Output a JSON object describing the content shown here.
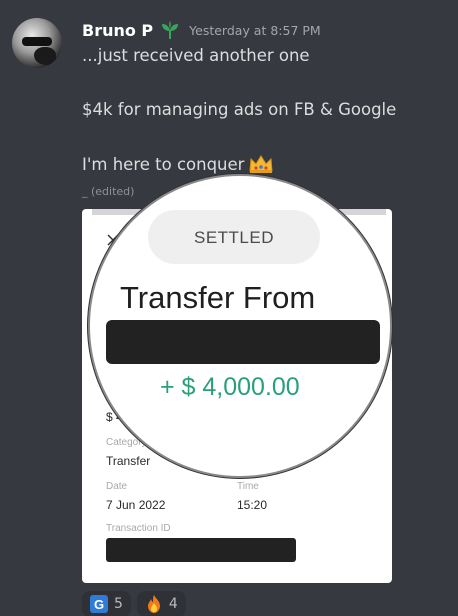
{
  "message": {
    "username": "Bruno P",
    "timestamp": "Yesterday at 8:57 PM",
    "lines": [
      "...just received another one",
      "$4k for managing ads on FB & Google",
      "I'm here to conquer"
    ],
    "edited_label": "(edited)"
  },
  "attachment": {
    "status": "SETTLED",
    "title": "Transfer From",
    "amount": "+ $ 4,000.00",
    "amount_color": "#2a9f7c",
    "fields": {
      "amount_label_partial": "A",
      "amount_value_partial": "$ 4,0",
      "category_label": "Category",
      "category_value": "Transfer",
      "date_label": "Date",
      "date_value": "7 Jun 2022",
      "time_label": "Time",
      "time_value": "15:20",
      "transaction_id_label": "Transaction ID"
    }
  },
  "reactions": [
    {
      "icon": "g-emoji-icon",
      "badge": "G",
      "count": "5"
    },
    {
      "icon": "fire-emoji-icon",
      "count": "4"
    }
  ],
  "colors": {
    "background": "#36393f",
    "username": "#ffffff",
    "timestamp": "#a3a6aa",
    "reaction_bg": "#2f3136"
  }
}
